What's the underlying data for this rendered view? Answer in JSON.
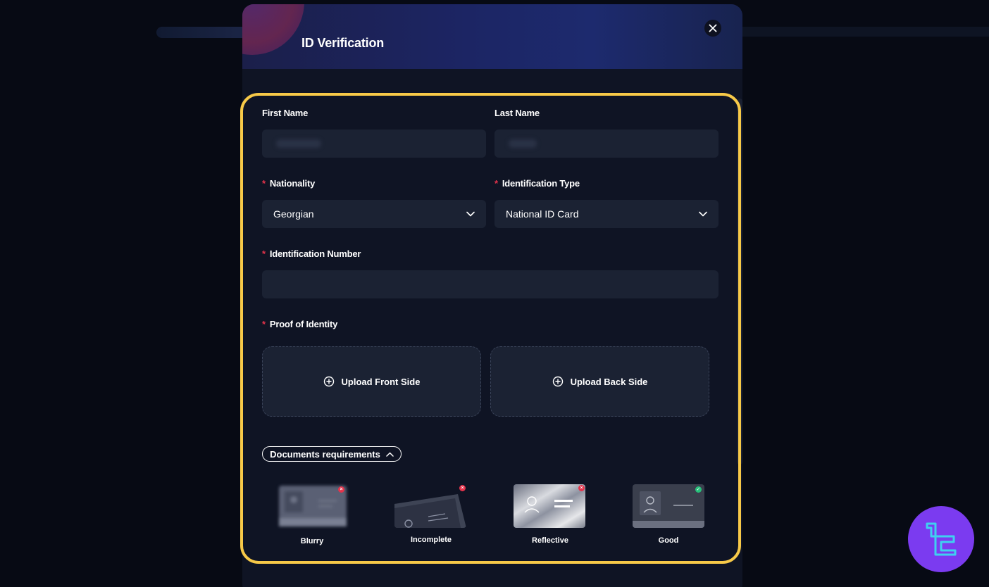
{
  "modal": {
    "title": "ID Verification",
    "close_label": "×"
  },
  "form": {
    "first_name_label": "First Name",
    "last_name_label": "Last Name",
    "first_name_value": "",
    "last_name_value": "",
    "nationality_label": "Nationality",
    "nationality_value": "Georgian",
    "id_type_label": "Identification Type",
    "id_type_value": "National ID Card",
    "id_number_label": "Identification Number",
    "id_number_value": "",
    "proof_label": "Proof of Identity",
    "upload_front": "Upload Front Side",
    "upload_back": "Upload Back Side",
    "required_mark": "*"
  },
  "requirements": {
    "toggle_label": "Documents requirements",
    "samples": [
      {
        "label": "Blurry",
        "status": "bad"
      },
      {
        "label": "Incomplete",
        "status": "bad"
      },
      {
        "label": "Reflective",
        "status": "bad"
      },
      {
        "label": "Good",
        "status": "good"
      }
    ]
  },
  "colors": {
    "accent_highlight": "#f7c948",
    "required": "#e5334b",
    "bad_badge": "#e5334b",
    "good_badge": "#27c07a",
    "logo": "#7b3bf0"
  }
}
